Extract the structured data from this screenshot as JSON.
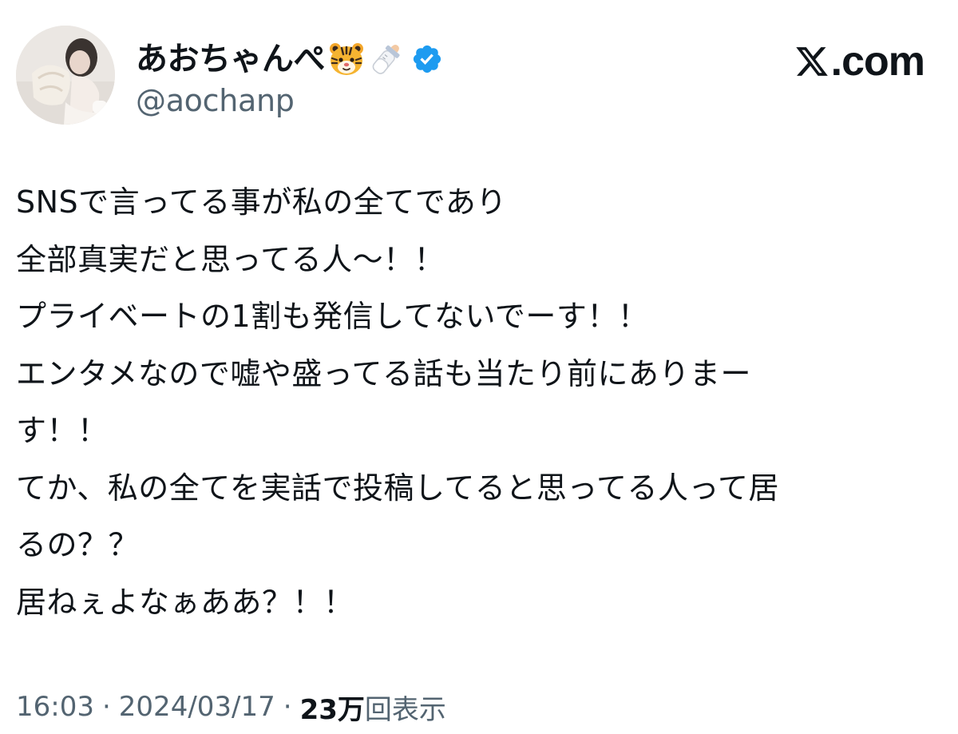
{
  "author": {
    "display_name": "あおちゃんぺ",
    "handle": "@aochanp",
    "emoji_icons": [
      "tiger-face-emoji",
      "baby-bottle-emoji"
    ],
    "verified": true,
    "verified_color": "#1d9bf0"
  },
  "brand": {
    "label": ".com",
    "logo_icon": "x-logo-icon"
  },
  "tweet": {
    "lines": [
      "SNSで言ってる事が私の全てであり",
      "全部真実だと思ってる人〜！！",
      "プライベートの1割も発信してないでーす！！",
      "エンタメなので嘘や盛ってる話も当たり前にありまー",
      "す！！",
      "てか、私の全てを実話で投稿してると思ってる人って居",
      "るの？？",
      "居ねぇよなぁああ？！！"
    ]
  },
  "meta": {
    "time": "16:03",
    "separator": "·",
    "date": "2024/03/17",
    "views_count": "23万",
    "views_label": "回表示"
  },
  "colors": {
    "text_primary": "#0f1419",
    "text_secondary": "#536471",
    "background": "#ffffff"
  }
}
